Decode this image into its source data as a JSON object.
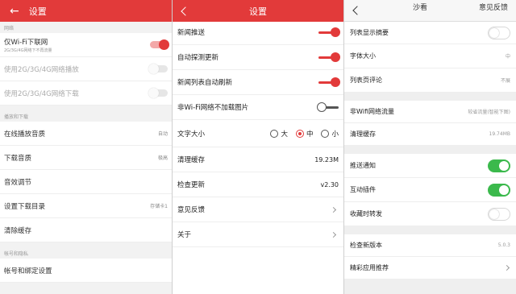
{
  "colors": {
    "accent_red": "#e23a3a",
    "accent_green": "#3bb94c"
  },
  "panel1": {
    "header_title": "设置",
    "sections": [
      {
        "label": "网络",
        "rows": [
          {
            "label": "仅Wi-Fi下联网",
            "sub": "2G/3G/4G网络下不再流量",
            "toggle": "on"
          },
          {
            "label": "使用2G/3G/4G网络播放",
            "toggle": "off",
            "disabled": true
          },
          {
            "label": "使用2G/3G/4G网络下载",
            "toggle": "off",
            "disabled": true
          }
        ]
      },
      {
        "label": "播放和下载",
        "rows": [
          {
            "label": "在线播放音质",
            "value": "自动"
          },
          {
            "label": "下载音质",
            "value": "极高"
          },
          {
            "label": "音效调节"
          },
          {
            "label": "设置下载目录",
            "value": "存储卡1"
          },
          {
            "label": "清除缓存"
          }
        ]
      },
      {
        "label": "帐号和隐私",
        "rows": [
          {
            "label": "帐号和绑定设置"
          }
        ]
      }
    ]
  },
  "panel2": {
    "header_title": "设置",
    "rows": [
      {
        "label": "新闻推送",
        "toggle": "on"
      },
      {
        "label": "自动探测更新",
        "toggle": "on"
      },
      {
        "label": "新闻列表自动刷新",
        "toggle": "on"
      },
      {
        "label": "非Wi-Fi网络不加载图片",
        "toggle": "off"
      }
    ],
    "font_size": {
      "label": "文字大小",
      "options": [
        "大",
        "中",
        "小"
      ],
      "selected": "中"
    },
    "rows2": [
      {
        "label": "清理缓存",
        "value": "19.23M"
      },
      {
        "label": "检查更新",
        "value": "v2.30"
      },
      {
        "label": "意见反馈",
        "chevron": true
      },
      {
        "label": "关于",
        "chevron": true
      }
    ]
  },
  "panel3": {
    "header_left": "沙看",
    "header_right": "意见反馈",
    "group1": [
      {
        "label": "列表显示摘要",
        "toggle": "off"
      },
      {
        "label": "字体大小",
        "value": "中"
      },
      {
        "label": "列表页评论",
        "value": "不展"
      }
    ],
    "group2": [
      {
        "label": "非Wifi网络流量",
        "value": "较省流量(智能下图)"
      },
      {
        "label": "清理缓存",
        "value": "19.74MB"
      }
    ],
    "group3": [
      {
        "label": "推送通知",
        "toggle": "on"
      },
      {
        "label": "互动插件",
        "toggle": "on"
      },
      {
        "label": "收藏时转发",
        "toggle": "off"
      }
    ],
    "group4": [
      {
        "label": "检查新版本",
        "value": "5.0.3"
      },
      {
        "label": "精彩应用推荐",
        "chevron": true
      }
    ]
  }
}
